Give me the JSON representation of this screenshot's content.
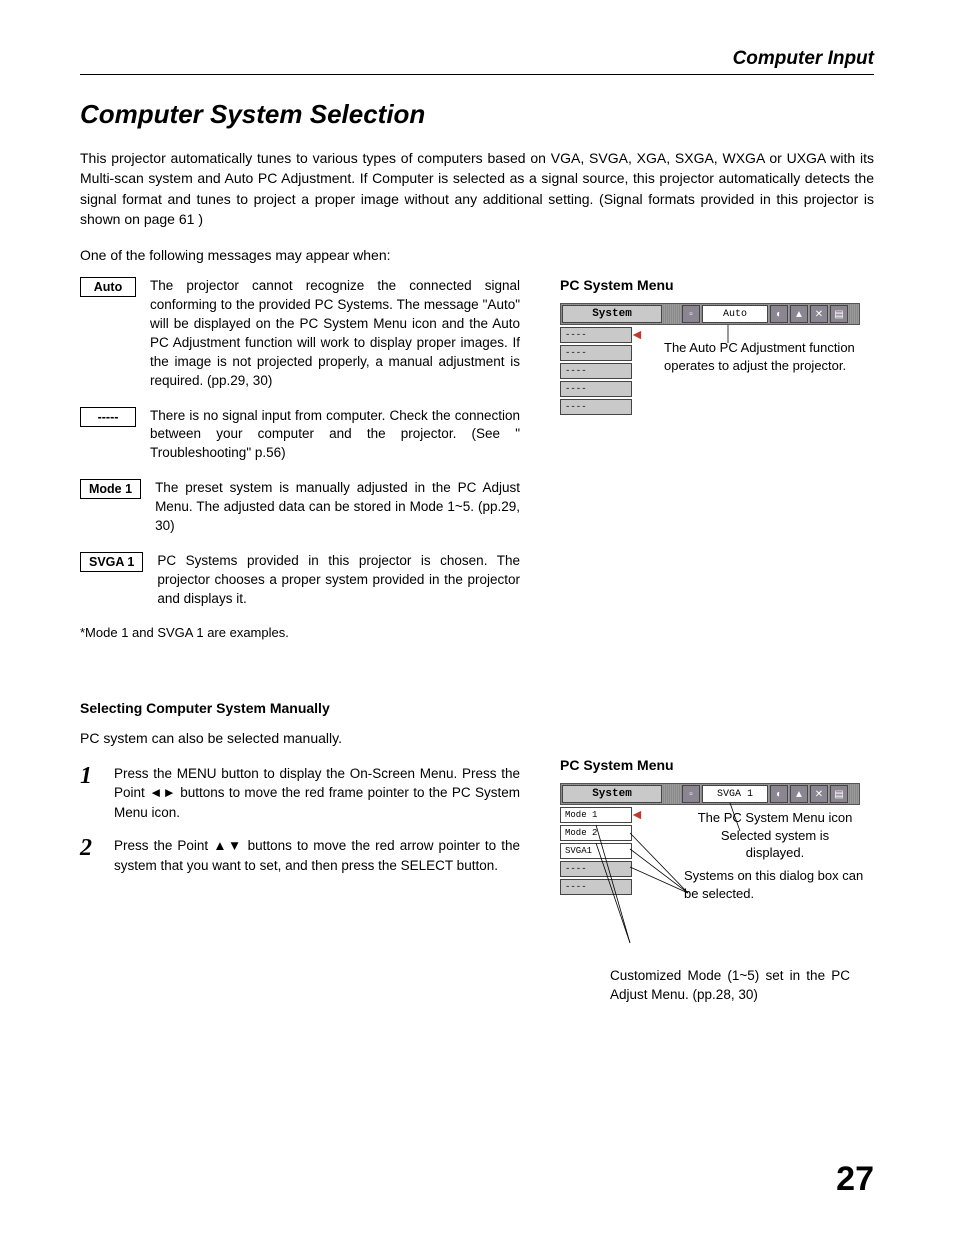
{
  "header": {
    "section": "Computer Input"
  },
  "page": {
    "title": "Computer System Selection",
    "intro": "This projector automatically tunes to various types of computers based on VGA, SVGA, XGA, SXGA, WXGA or UXGA with its Multi-scan system and Auto PC Adjustment.  If Computer is selected as a signal source, this projector automatically detects the signal format and tunes to project a proper image without any additional setting.  (Signal formats provided in this projector is shown on page 61 )",
    "lead": "One of the following messages may appear when:",
    "messages": [
      {
        "label": "Auto",
        "text": "The projector cannot recognize the connected signal conforming to the provided PC Systems.  The message \"Auto\" will be displayed on the PC System Menu icon and the Auto PC Adjustment function will work to display proper images.  If the image is not projected properly, a manual adjustment is required.  (pp.29, 30)"
      },
      {
        "label": "-----",
        "text": "There is no signal input from computer.  Check the connection between your computer and the projector.  (See \" Troubleshooting\" p.56)"
      },
      {
        "label": "Mode 1",
        "text": "The preset system is manually adjusted in the PC Adjust Menu.  The adjusted data can be stored in Mode 1~5.  (pp.29, 30)"
      },
      {
        "label": "SVGA 1",
        "text": "PC Systems provided in this projector is chosen. The projector chooses a proper system provided in the projector and displays it."
      }
    ],
    "footnote": "*Mode 1 and SVGA 1 are examples.",
    "manual": {
      "heading": "Selecting Computer System Manually",
      "para": "PC system can also be selected manually.",
      "steps": [
        {
          "num": "1",
          "text_a": "Press the MENU button to display the On-Screen Menu.  Press the Point ",
          "text_b": " buttons to move the red frame pointer to the PC System Menu icon."
        },
        {
          "num": "2",
          "text_a": "Press the Point ",
          "text_b": " buttons to move the red arrow pointer to the system that you want to set, and then press the SELECT button."
        }
      ],
      "arrows_lr": "◄►",
      "arrows_ud": "▲▼"
    },
    "menu1": {
      "title": "PC System Menu",
      "system_label": "System",
      "toolbar_label": "Auto",
      "list": [
        "----",
        "----",
        "----",
        "----",
        "----"
      ],
      "annotation": "The Auto PC Adjustment function operates to adjust the projector."
    },
    "menu2": {
      "title": "PC System Menu",
      "system_label": "System",
      "toolbar_label": "SVGA 1",
      "list": [
        "Mode 1",
        "Mode 2",
        "SVGA1",
        "----",
        "----"
      ],
      "annotation_a1": "The PC System Menu icon",
      "annotation_a2": "Selected system is displayed.",
      "annotation_b": "Systems on this dialog box can be selected.",
      "caption": "Customized Mode (1~5) set in the PC Adjust Menu.  (pp.28, 30)"
    },
    "number": "27"
  }
}
